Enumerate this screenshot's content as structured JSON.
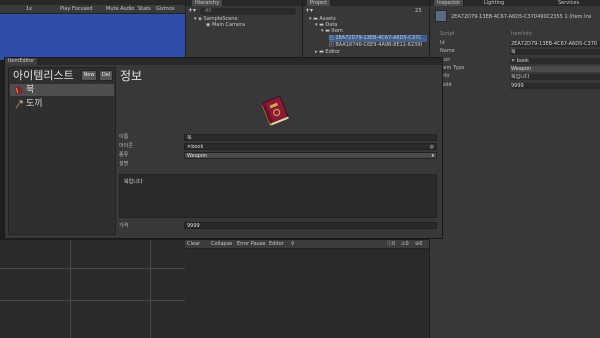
{
  "game_toolbar": {
    "scale": "1x",
    "play_mode": "Play Focused",
    "mute": "Mute Audio",
    "stats": "Stats",
    "gizmos": "Gizmos"
  },
  "hierarchy": {
    "tab": "Hierarchy",
    "search_placeholder": "All",
    "scene": "SampleScene",
    "children": [
      "Main Camera"
    ]
  },
  "project": {
    "tab": "Project",
    "count": "23",
    "root": "Assets",
    "folders": [
      "Data",
      "Item"
    ],
    "files": [
      "2EA72D79-13EB-4C67-A6D5-C37C",
      "BAA18746-C6E9-4A9B-8E11-6239("
    ],
    "more": "Editor"
  },
  "inspector": {
    "tabs": [
      "Inspector",
      "Lighting",
      "Services"
    ],
    "header": "2EA72D79-13EB-4C67-A6D5-C370490C2355 1 (Item Ins",
    "rows": [
      {
        "label": "Script",
        "value": "ItemInfo"
      },
      {
        "label": "Id",
        "value": "2EA72D79-13EB-4C67-A6D5-C370"
      },
      {
        "label": "Name",
        "value": "북"
      },
      {
        "label": "Icon",
        "value": "book"
      },
      {
        "label": "Item Type",
        "value": "Weapon"
      },
      {
        "label": "Info",
        "value": "북입니다"
      },
      {
        "label": "Gold",
        "value": "9999"
      }
    ]
  },
  "console": {
    "clear": "Clear",
    "collapse": "Collapse",
    "error_pause": "Error Pause",
    "editor": "Editor",
    "counts": [
      "0",
      "0",
      "0"
    ]
  },
  "editor": {
    "tab": "ItemEditor",
    "list_title": "아이템리스트",
    "new_label": "New",
    "del_label": "Del",
    "items": [
      {
        "name": "북",
        "icon": "book-icon",
        "selected": true
      },
      {
        "name": "도끼",
        "icon": "axe-icon",
        "selected": false
      }
    ],
    "detail_title": "정보",
    "fields": {
      "name_label": "이름",
      "name_value": "북",
      "icon_label": "아이콘",
      "icon_value": "book",
      "type_label": "종류",
      "type_value": "Weapon",
      "info_label": "설명",
      "info_value": "북입니다",
      "gold_label": "가격",
      "gold_value": "9999"
    }
  },
  "colors": {
    "game_view": "#2d4fa8",
    "panel": "#383838",
    "book_cover": "#8b1a3a",
    "book_gold": "#d4a83a"
  }
}
